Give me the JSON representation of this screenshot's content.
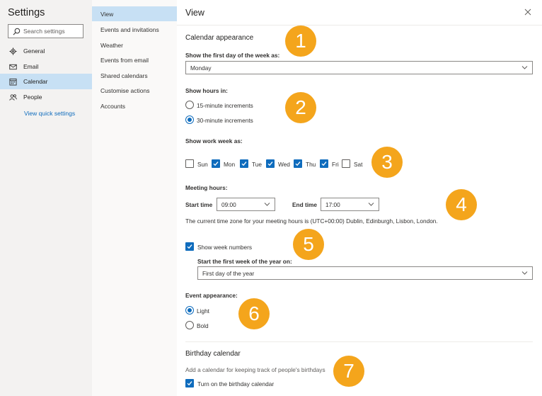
{
  "sidebar": {
    "title": "Settings",
    "search_placeholder": "Search settings",
    "items": [
      {
        "label": "General",
        "icon": "gear-icon"
      },
      {
        "label": "Email",
        "icon": "mail-icon"
      },
      {
        "label": "Calendar",
        "icon": "calendar-icon"
      },
      {
        "label": "People",
        "icon": "people-icon"
      }
    ],
    "quick_settings_link": "View quick settings"
  },
  "subnav": {
    "items": [
      "View",
      "Events and invitations",
      "Weather",
      "Events from email",
      "Shared calendars",
      "Customise actions",
      "Accounts"
    ],
    "active": "View"
  },
  "main": {
    "title": "View",
    "calendar_appearance": {
      "heading": "Calendar appearance",
      "first_day_label": "Show the first day of the week as:",
      "first_day_value": "Monday"
    },
    "hours": {
      "label": "Show hours in:",
      "options": [
        "15-minute increments",
        "30-minute increments"
      ],
      "selected": "30-minute increments"
    },
    "work_week": {
      "label": "Show work week as:",
      "days": [
        {
          "label": "Sun",
          "checked": false
        },
        {
          "label": "Mon",
          "checked": true
        },
        {
          "label": "Tue",
          "checked": true
        },
        {
          "label": "Wed",
          "checked": true
        },
        {
          "label": "Thu",
          "checked": true
        },
        {
          "label": "Fri",
          "checked": true
        },
        {
          "label": "Sat",
          "checked": false
        }
      ]
    },
    "meeting_hours": {
      "label": "Meeting hours:",
      "start_label": "Start time",
      "start_value": "09:00",
      "end_label": "End time",
      "end_value": "17:00",
      "timezone_note": "The current time zone for your meeting hours is (UTC+00:00) Dublin, Edinburgh, Lisbon, London."
    },
    "week_numbers": {
      "checkbox_label": "Show week numbers",
      "checked": true,
      "first_week_label": "Start the first week of the year on:",
      "first_week_value": "First day of the year"
    },
    "event_appearance": {
      "label": "Event appearance:",
      "options": [
        "Light",
        "Bold"
      ],
      "selected": "Light"
    },
    "birthday": {
      "heading": "Birthday calendar",
      "description": "Add a calendar for keeping track of people's birthdays",
      "checkbox_label": "Turn on the birthday calendar",
      "checked": true
    }
  },
  "callouts": [
    "1",
    "2",
    "3",
    "4",
    "5",
    "6",
    "7"
  ],
  "colors": {
    "accent": "#0f6cbd",
    "selection": "#c7e0f4",
    "marker": "#f4a51c"
  }
}
